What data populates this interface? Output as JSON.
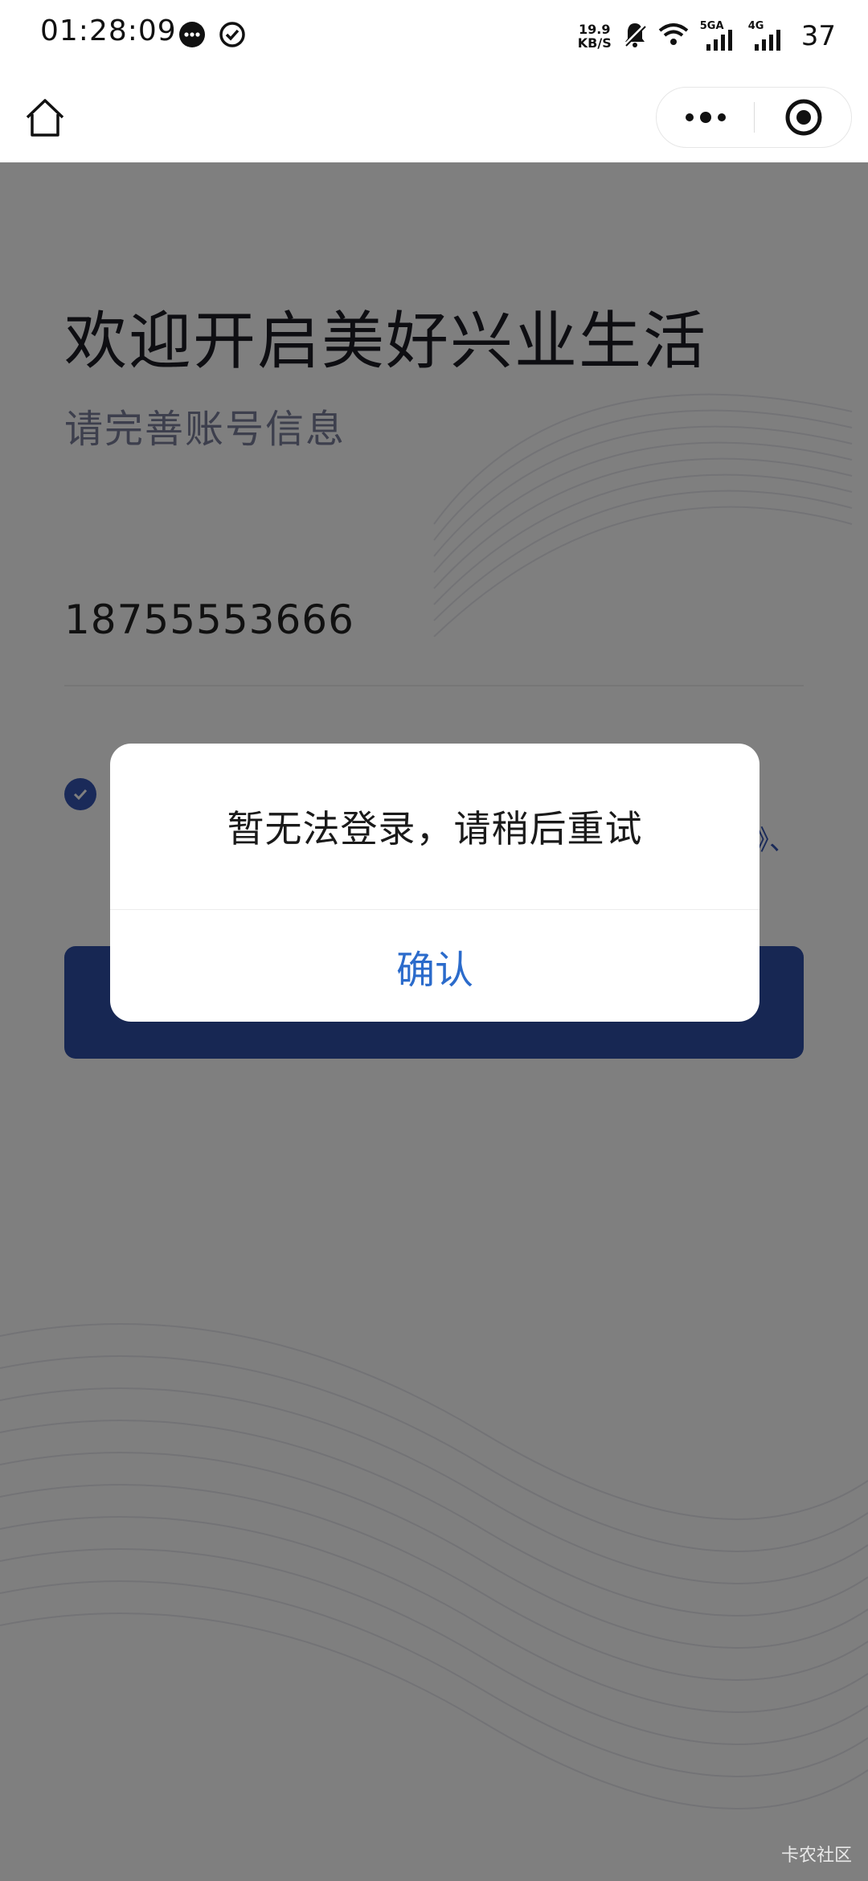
{
  "status_bar": {
    "time": "01:28:09",
    "net_speed_value": "19.9",
    "net_speed_unit": "KB/S",
    "network_labels": [
      "5GA",
      "4G"
    ],
    "battery": "37",
    "icons": [
      "message-bubble-icon",
      "check-circle-icon",
      "bell-muted-icon",
      "wifi-icon",
      "signal-icon",
      "signal-icon"
    ]
  },
  "navbar": {
    "home_icon": "home-icon",
    "more_icon": "more-dots-icon",
    "close_icon": "target-close-icon"
  },
  "page": {
    "title": "欢迎开启美好兴业生活",
    "subtitle": "请完善账号信息",
    "phone": "18755553666",
    "agreement_visible_link_fragment": "》、",
    "checkbox_checked": true,
    "accent_color": "#2f4fa7"
  },
  "modal": {
    "message": "暂无法登录，请稍后重试",
    "confirm_label": "确认",
    "confirm_color": "#2b6bcb"
  },
  "watermark": "卡农社区"
}
